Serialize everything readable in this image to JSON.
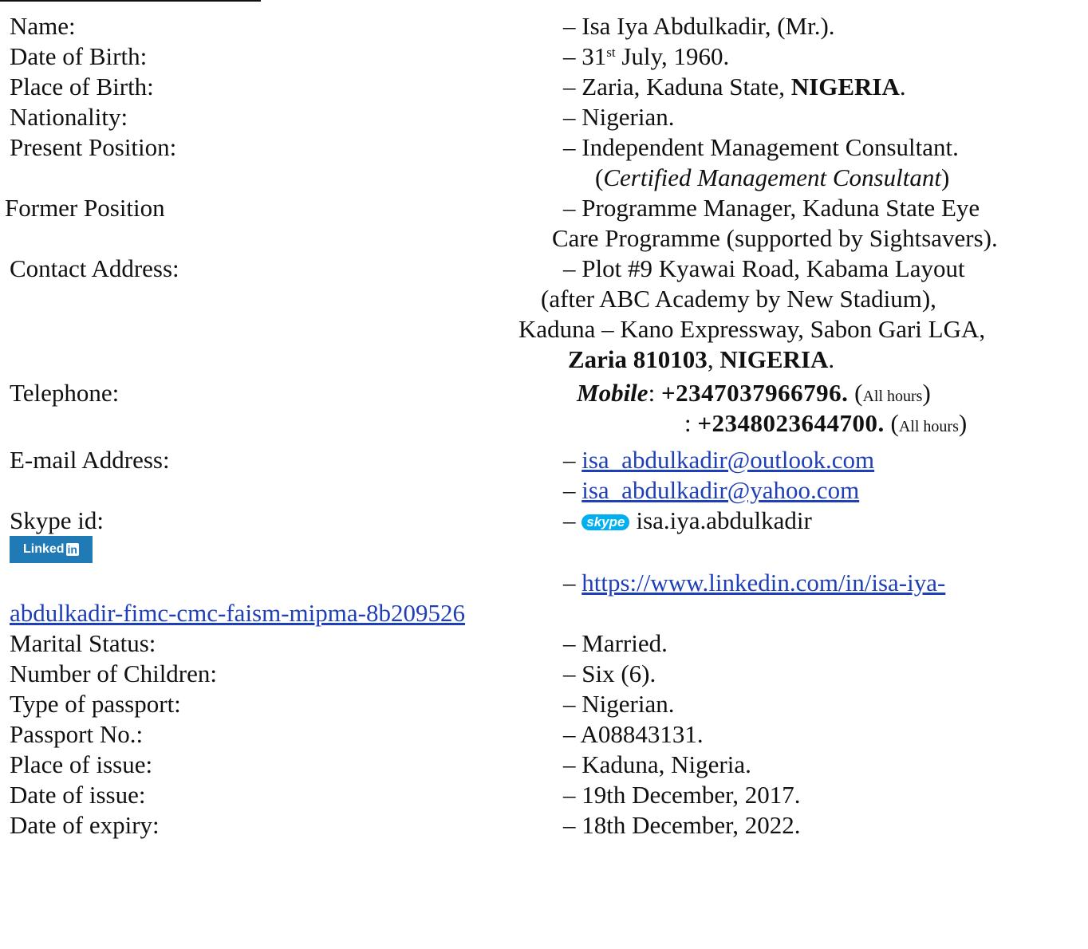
{
  "rows": {
    "name": {
      "label": "Name:",
      "value": "Isa Iya Abdulkadir, (Mr.)."
    },
    "dob": {
      "label": "Date of Birth:",
      "day": "31",
      "sup": "st",
      "rest": " July, 1960."
    },
    "pob": {
      "label": "Place of Birth:",
      "value": "Zaria, Kaduna State, ",
      "country": "NIGERIA"
    },
    "nationality": {
      "label": "Nationality:",
      "value": "Nigerian."
    },
    "present": {
      "label": "Present Position:",
      "value": "Independent Management Consultant.",
      "note": "Certified Management Consultant"
    },
    "former": {
      "label": "Former Position",
      "value1": "Programme Manager, Kaduna State Eye",
      "value2": "Care Programme (supported by Sightsavers)."
    },
    "address": {
      "label": "Contact Address:",
      "line1": "Plot #9 Kyawai Road, Kabama Layout",
      "line2": "(after ABC Academy by New Stadium),",
      "line3": "Kaduna – Kano Expressway, Sabon Gari LGA,",
      "city": "Zaria 810103",
      "country": "NIGERIA"
    },
    "telephone": {
      "label": "Telephone:",
      "mobile_label": "Mobile",
      "phone1": "+2347037966796.",
      "phone2": "+2348023644700.",
      "hours": "All hours"
    },
    "email": {
      "label": "E-mail Address:",
      "email1": "isa_abdulkadir@outlook.com",
      "email2": "isa_abdulkadir@yahoo.com"
    },
    "skype": {
      "label": "Skype id:",
      "logo": "skype",
      "value": "isa.iya.abdulkadir"
    },
    "linkedin": {
      "logo_text": "Linked",
      "logo_in": "in",
      "url_part1": "https://www.linkedin.com/in/isa-iya-",
      "url_part2": "abdulkadir-fimc-cmc-faism-mipma-8b209526"
    },
    "marital": {
      "label": "Marital Status:",
      "value": "Married."
    },
    "children": {
      "label": "Number of Children:",
      "value": "Six (6)."
    },
    "passport_type": {
      "label": "Type of passport:",
      "value": "Nigerian."
    },
    "passport_no": {
      "label": "Passport No.:",
      "value": "A08843131."
    },
    "issue_place": {
      "label": "Place of issue:",
      "value": "Kaduna, Nigeria."
    },
    "issue_date": {
      "label": "Date of issue:",
      "value": "19th December, 2017."
    },
    "expiry_date": {
      "label": "Date of expiry:",
      "value": "18th December, 2022."
    }
  },
  "dash": "–",
  "colors": {
    "link": "#1f3fb8",
    "skype": "#00aff0",
    "linkedin": "#1f7ab5"
  }
}
